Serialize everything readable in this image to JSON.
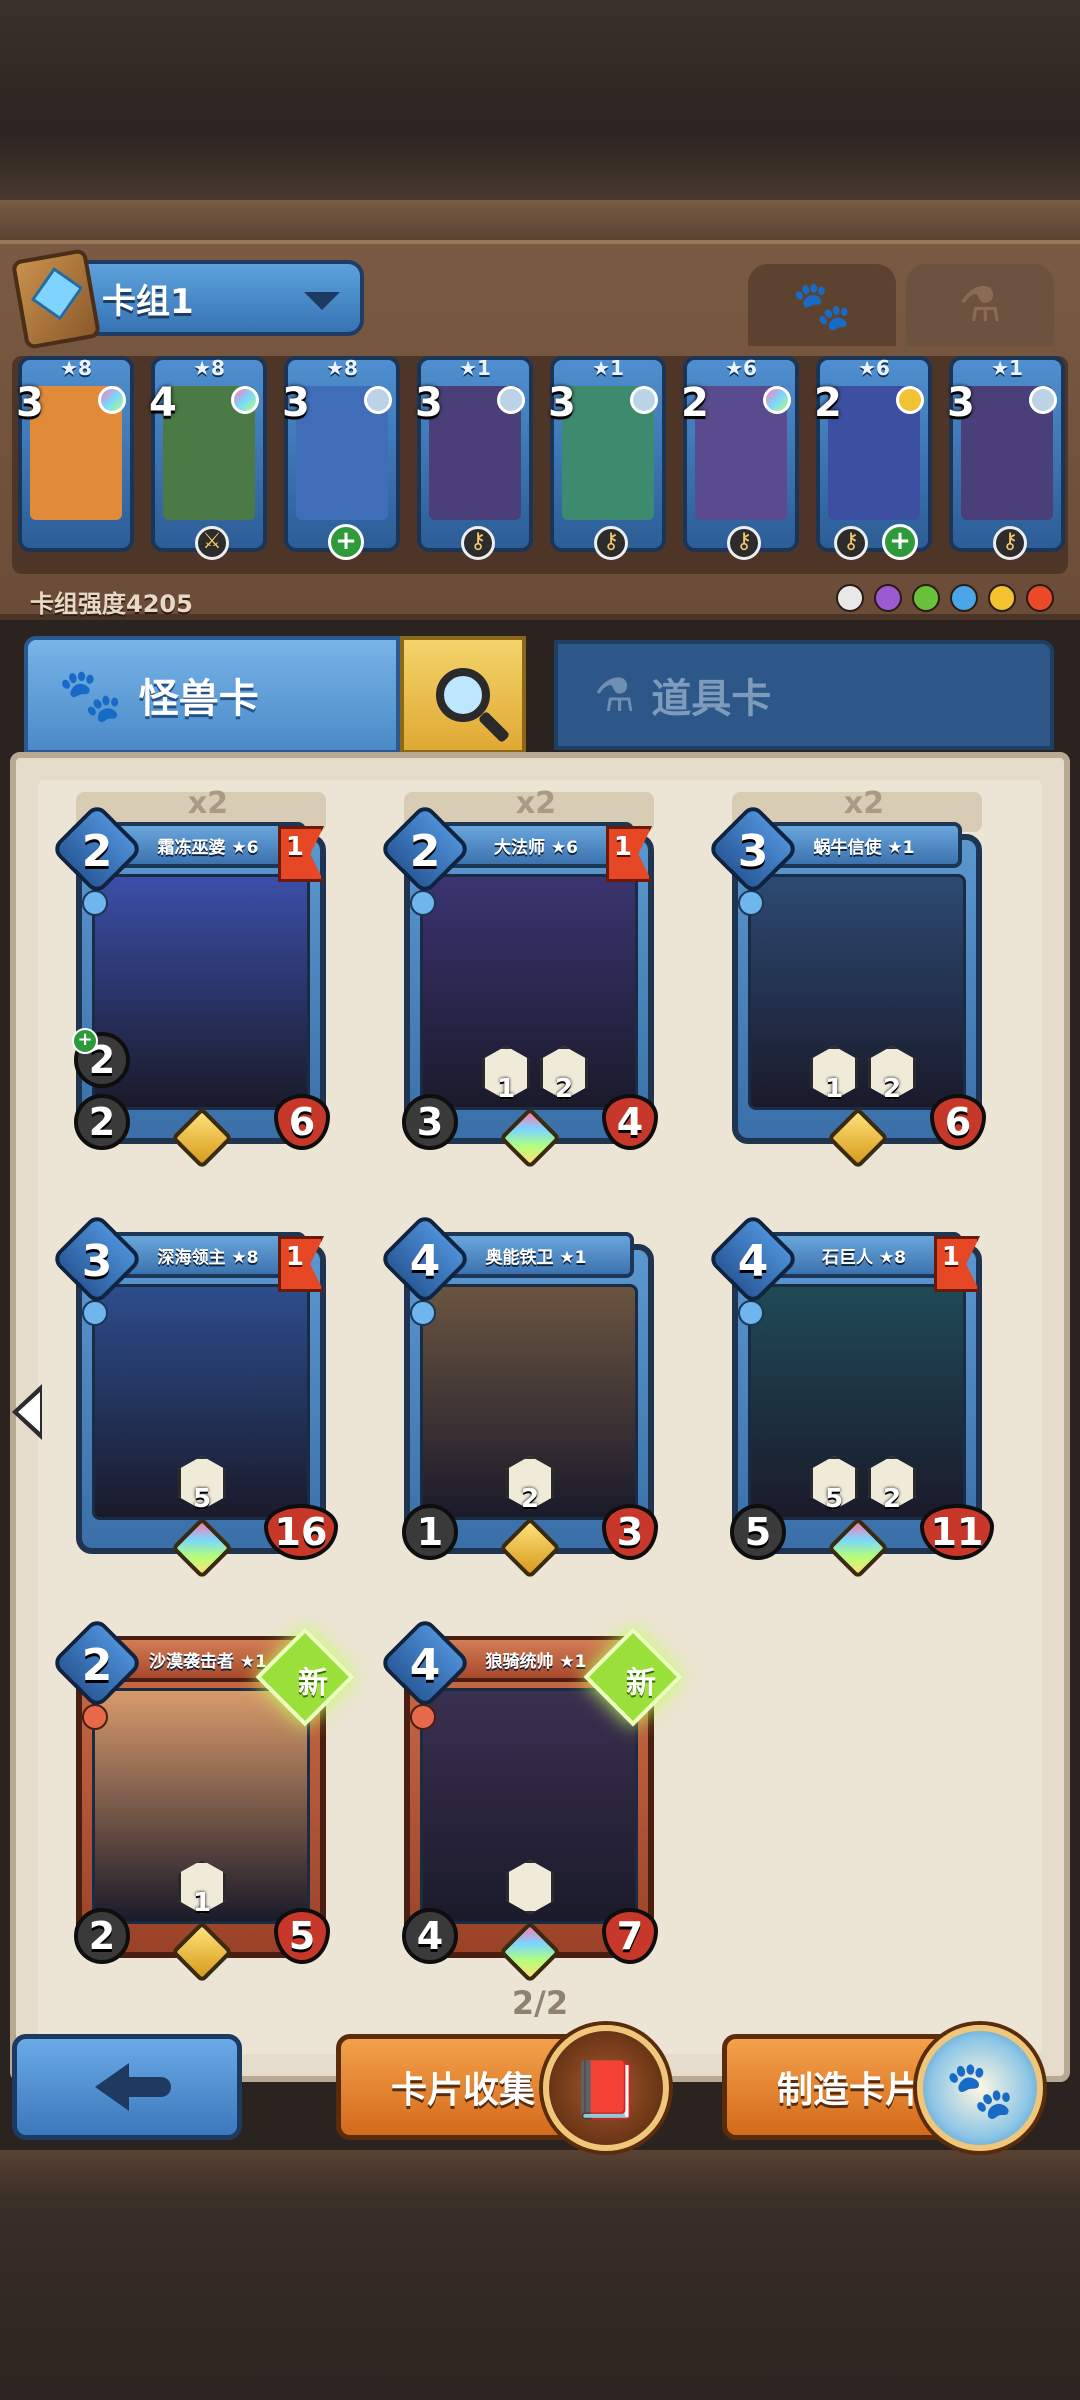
{
  "deck": {
    "name": "卡组1",
    "power_label": "卡组强度4205",
    "mode_tabs": [
      {
        "icon": "paw-icon",
        "active": true
      },
      {
        "icon": "potion-icon",
        "active": false
      }
    ],
    "cards": [
      {
        "cost": "3",
        "stars": "★8",
        "art": "#e08a3a",
        "gem": "rainbow"
      },
      {
        "cost": "4",
        "stars": "★8",
        "art": "#4b7a46",
        "gem": "rainbow",
        "item": "sword"
      },
      {
        "cost": "3",
        "stars": "★8",
        "art": "#3f6db8",
        "gem": "silver",
        "item": "plus"
      },
      {
        "cost": "3",
        "stars": "★1",
        "art": "#4a3f78",
        "gem": "silver",
        "item": "key"
      },
      {
        "cost": "3",
        "stars": "★1",
        "art": "#3e8a6e",
        "gem": "silver",
        "item": "key"
      },
      {
        "cost": "2",
        "stars": "★6",
        "art": "#5a4b8e",
        "gem": "rainbow",
        "item": "key"
      },
      {
        "cost": "2",
        "stars": "★6",
        "art": "#3c4fa0",
        "gem": "gold",
        "item": "key",
        "item2": "plus"
      },
      {
        "cost": "3",
        "stars": "★1",
        "art": "#4a3f78",
        "gem": "silver",
        "item": "key"
      }
    ],
    "tribe_colors": [
      "#e8e8e8",
      "#9a5ad0",
      "#6ac23a",
      "#4aa6e6",
      "#f2c230",
      "#e84a2a"
    ]
  },
  "tabs": {
    "monster_label": "怪兽卡",
    "item_label": "道具卡"
  },
  "collection": {
    "counts": [
      "x2",
      "x2",
      "x2"
    ],
    "cards": [
      {
        "name": "霜冻巫婆 ★6",
        "cost": "2",
        "atk": "2",
        "hp": "6",
        "bonus": "2",
        "flag": "1",
        "rarity": "gold",
        "art": "#3a4fa8",
        "abilities": []
      },
      {
        "name": "大法师 ★6",
        "cost": "2",
        "atk": "3",
        "hp": "4",
        "flag": "1",
        "rarity": "rainbow",
        "art": "#3b3470",
        "abilities": [
          "1",
          "2"
        ]
      },
      {
        "name": "蜗牛信使 ★1",
        "cost": "3",
        "atk": "",
        "hp": "6",
        "rarity": "gold",
        "art": "#2c4a72",
        "abilities": [
          "1",
          "2"
        ]
      },
      {
        "name": "深海领主 ★8",
        "cost": "3",
        "atk": "",
        "hp": "16",
        "flag": "1",
        "rarity": "rainbow",
        "art": "#2c4d8c",
        "abilities": [
          "5"
        ]
      },
      {
        "name": "奥能铁卫 ★1",
        "cost": "4",
        "atk": "1",
        "hp": "3",
        "rarity": "gold",
        "art": "#6a5440",
        "abilities": [
          "2"
        ]
      },
      {
        "name": "石巨人 ★8",
        "cost": "4",
        "atk": "5",
        "hp": "11",
        "flag": "1",
        "rarity": "rainbow",
        "art": "#1e4a56",
        "abilities": [
          "5",
          "2"
        ]
      },
      {
        "name": "沙漠袭击者 ★1",
        "cost": "2",
        "atk": "2",
        "hp": "5",
        "new": "新",
        "rarity": "gold",
        "art": "#d89a6a",
        "abilities": [
          "1"
        ]
      },
      {
        "name": "狼骑统帅 ★1",
        "cost": "4",
        "atk": "4",
        "hp": "7",
        "new": "新",
        "rarity": "rainbow",
        "art": "#3a3050",
        "abilities": [
          ""
        ]
      }
    ],
    "page": "2/2"
  },
  "footer": {
    "collect_label": "卡片收集",
    "craft_label": "制造卡片"
  }
}
